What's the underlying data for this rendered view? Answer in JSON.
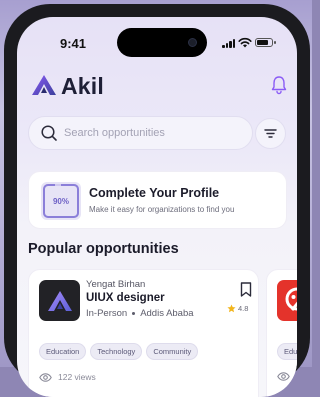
{
  "status_bar": {
    "time": "9:41"
  },
  "header": {
    "brand": "Akil"
  },
  "search": {
    "placeholder": "Search opportunities"
  },
  "profile_card": {
    "percent": "90%",
    "completion": 0.9,
    "title": "Complete Your Profile",
    "subtitle": "Make it easy for organizations to find you"
  },
  "section": {
    "title": "Popular opportunities"
  },
  "opportunities": [
    {
      "company": "Yengat Birhan",
      "role": "UIUX designer",
      "mode": "In-Person",
      "location": "Addis Ababa",
      "rating": "4.8",
      "tags": [
        "Education",
        "Technology",
        "Community"
      ],
      "views": "122 views"
    },
    {
      "tag_partial": "Edu"
    }
  ],
  "colors": {
    "accent": "#6e61c6",
    "logo_dark": "#222226",
    "peek_logo": "#e4332b",
    "star": "#f2b51c"
  }
}
